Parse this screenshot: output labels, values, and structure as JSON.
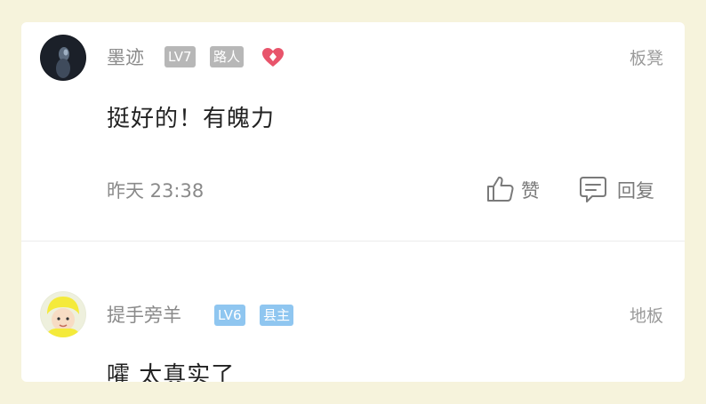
{
  "comments": [
    {
      "username": "墨迹",
      "level": "LV7",
      "title": "路人",
      "floor": "板凳",
      "content": "挺好的！有魄力",
      "time": "昨天 23:38",
      "has_heart_badge": true,
      "badge_color": "#b7b7b7"
    },
    {
      "username": "提手旁羊",
      "level": "LV6",
      "title": "县主",
      "floor": "地板",
      "content": "嚯 太真实了",
      "badge_color": "#8fc6f0"
    }
  ],
  "actions": {
    "like_label": "赞",
    "reply_label": "回复"
  },
  "colors": {
    "page_background": "#f6f3dc",
    "card_background": "#ffffff",
    "heart": "#e8546b"
  },
  "icons": [
    "thumbs-up-icon",
    "comment-icon",
    "heart-badge-icon"
  ]
}
